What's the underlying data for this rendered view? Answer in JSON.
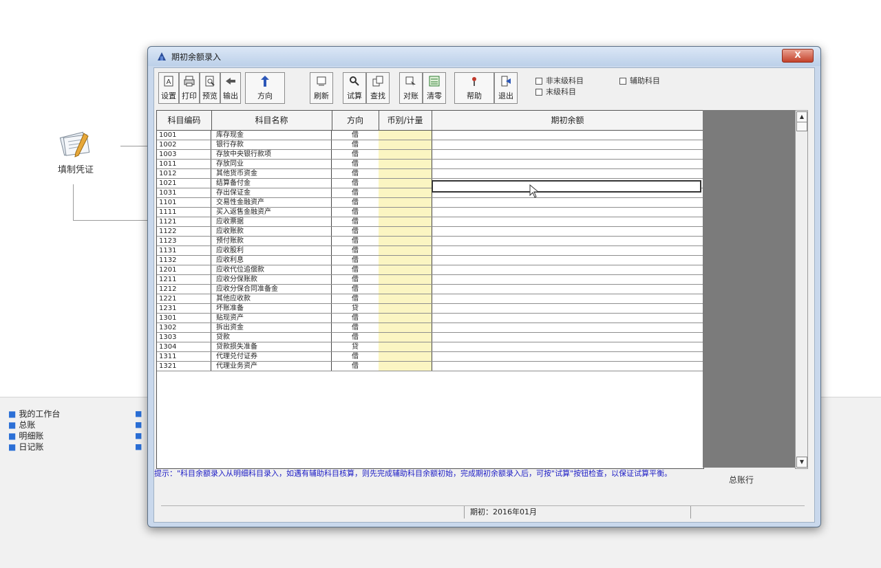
{
  "background": {
    "flow_node_label": "填制凭证",
    "nav_items": [
      "我的工作台",
      "总账",
      "明细账",
      "日记账"
    ]
  },
  "window": {
    "title": "期初余额录入",
    "close_label": "X"
  },
  "toolbar": {
    "buttons": [
      {
        "label": "设置",
        "icon": "settings-icon"
      },
      {
        "label": "打印",
        "icon": "print-icon"
      },
      {
        "label": "预览",
        "icon": "preview-icon"
      },
      {
        "label": "输出",
        "icon": "export-icon"
      },
      {
        "label": "方向",
        "icon": "direction-icon"
      },
      {
        "label": "刷新",
        "icon": "refresh-icon"
      },
      {
        "label": "试算",
        "icon": "trial-balance-icon"
      },
      {
        "label": "查找",
        "icon": "find-icon"
      },
      {
        "label": "对账",
        "icon": "reconcile-icon"
      },
      {
        "label": "清零",
        "icon": "clear-icon"
      },
      {
        "label": "帮助",
        "icon": "help-icon"
      },
      {
        "label": "退出",
        "icon": "exit-icon"
      }
    ],
    "legend": {
      "non_leaf": "非末级科目",
      "leaf": "末级科目",
      "auxiliary": "辅助科目"
    }
  },
  "grid": {
    "headers": [
      "科目编码",
      "科目名称",
      "方向",
      "币别/计量",
      "期初余额"
    ],
    "rows": [
      {
        "code": "1001",
        "name": "库存现金",
        "dir": "借"
      },
      {
        "code": "1002",
        "name": "银行存款",
        "dir": "借"
      },
      {
        "code": "1003",
        "name": "存放中央银行款项",
        "dir": "借"
      },
      {
        "code": "1011",
        "name": "存放同业",
        "dir": "借"
      },
      {
        "code": "1012",
        "name": "其他货币资金",
        "dir": "借"
      },
      {
        "code": "1021",
        "name": "结算备付金",
        "dir": "借"
      },
      {
        "code": "1031",
        "name": "存出保证金",
        "dir": "借"
      },
      {
        "code": "1101",
        "name": "交易性金融资产",
        "dir": "借"
      },
      {
        "code": "1111",
        "name": "买入返售金融资产",
        "dir": "借"
      },
      {
        "code": "1121",
        "name": "应收票据",
        "dir": "借"
      },
      {
        "code": "1122",
        "name": "应收账款",
        "dir": "借"
      },
      {
        "code": "1123",
        "name": "预付账款",
        "dir": "借"
      },
      {
        "code": "1131",
        "name": "应收股利",
        "dir": "借"
      },
      {
        "code": "1132",
        "name": "应收利息",
        "dir": "借"
      },
      {
        "code": "1201",
        "name": "应收代位追偿款",
        "dir": "借"
      },
      {
        "code": "1211",
        "name": "应收分保账款",
        "dir": "借"
      },
      {
        "code": "1212",
        "name": "应收分保合同准备金",
        "dir": "借"
      },
      {
        "code": "1221",
        "name": "其他应收款",
        "dir": "借"
      },
      {
        "code": "1231",
        "name": "坏账准备",
        "dir": "贷"
      },
      {
        "code": "1301",
        "name": "贴现资产",
        "dir": "借"
      },
      {
        "code": "1302",
        "name": "拆出资金",
        "dir": "借"
      },
      {
        "code": "1303",
        "name": "贷款",
        "dir": "借"
      },
      {
        "code": "1304",
        "name": "贷款损失准备",
        "dir": "贷"
      },
      {
        "code": "1311",
        "name": "代理兑付证券",
        "dir": "借"
      },
      {
        "code": "1321",
        "name": "代理业务资产",
        "dir": "借"
      }
    ]
  },
  "tip_text": "提示：\"科目余额录入从明细科目录入，如遇有辅助科目核算，则先完成辅助科目余额初始，完成期初余额录入后，可按\"试算\"按钮检查，以保证试算平衡。",
  "total_label": "总账行",
  "status": {
    "period": "期初：2016年01月"
  }
}
